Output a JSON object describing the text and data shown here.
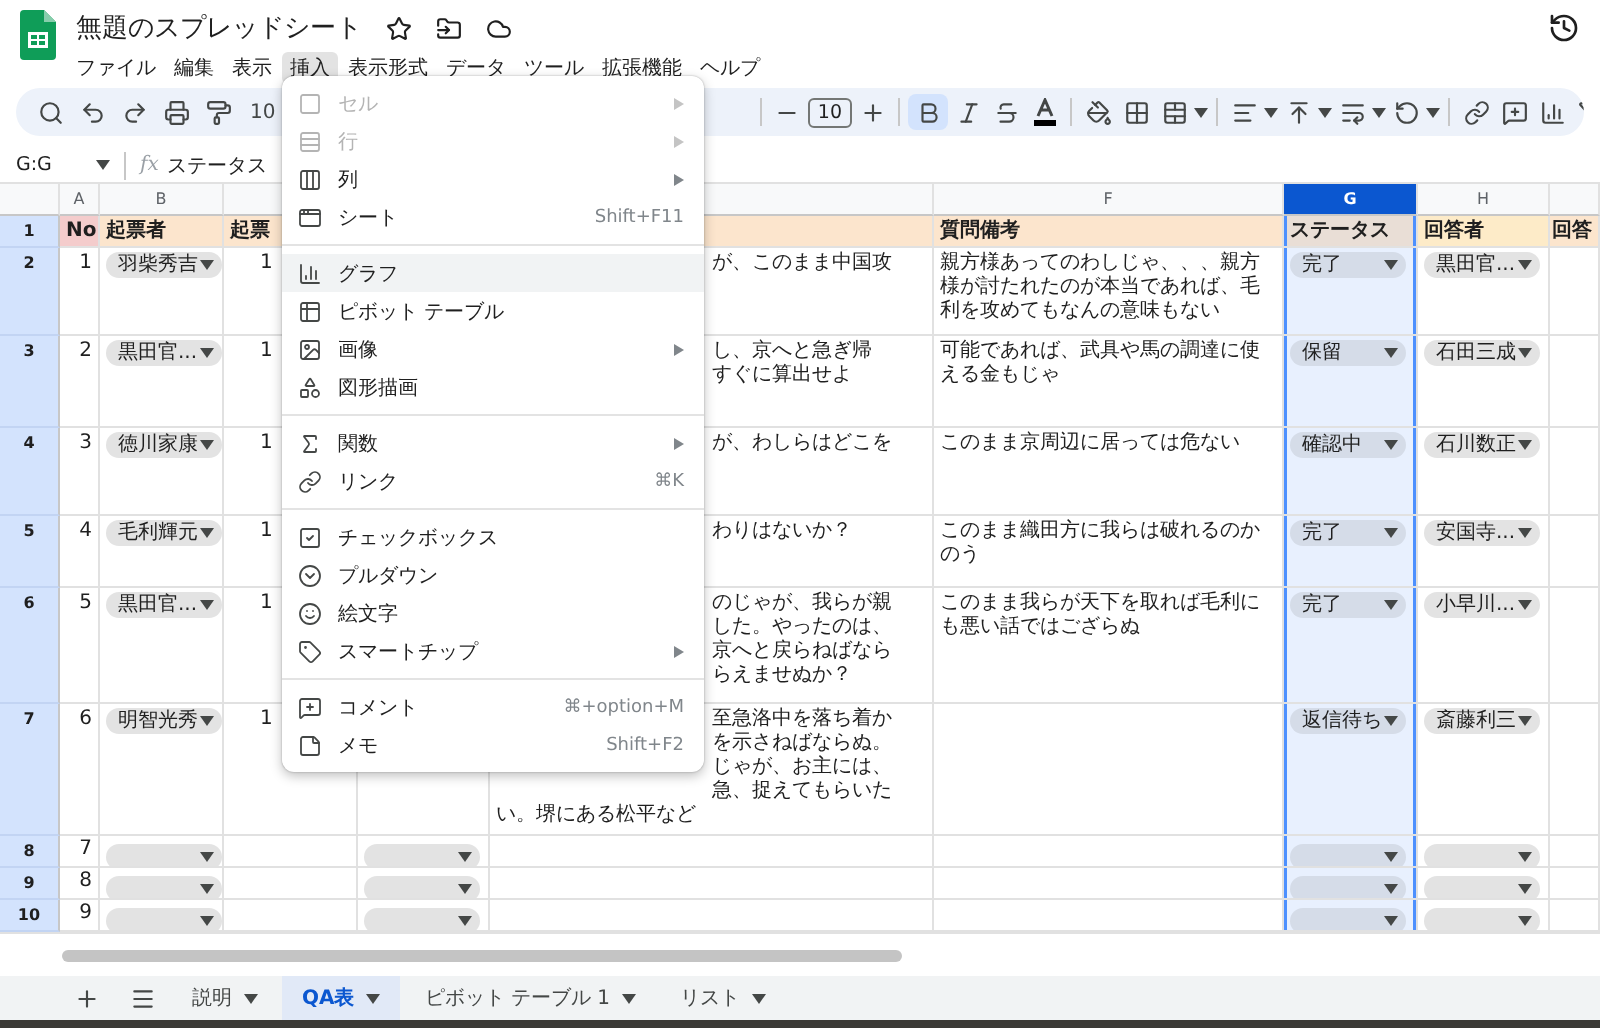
{
  "document": {
    "title": "無題のスプレッドシート"
  },
  "menubar": [
    {
      "label": "ファイル",
      "selected": false
    },
    {
      "label": "編集",
      "selected": false
    },
    {
      "label": "表示",
      "selected": false
    },
    {
      "label": "挿入",
      "selected": true
    },
    {
      "label": "表示形式",
      "selected": false
    },
    {
      "label": "データ",
      "selected": false
    },
    {
      "label": "ツール",
      "selected": false
    },
    {
      "label": "拡張機能",
      "selected": false
    },
    {
      "label": "ヘルプ",
      "selected": false
    }
  ],
  "toolbar": {
    "zoom": "10",
    "font_size": "10",
    "bold_selected": true
  },
  "formula_bar": {
    "name_box": "G:G",
    "fx_label": "fx",
    "content": "ステータス"
  },
  "column_headers": [
    {
      "letter": "A",
      "selected": false
    },
    {
      "letter": "B",
      "selected": false
    },
    {
      "letter": "F",
      "selected": false
    },
    {
      "letter": "G",
      "selected": true
    },
    {
      "letter": "H",
      "selected": false
    }
  ],
  "header_row": {
    "number": "1",
    "no": "No",
    "requester": "起票者",
    "column_c": "起票",
    "note": "質問備考",
    "status": "ステータス",
    "responder": "回答者",
    "column_i": "回答"
  },
  "rows": [
    {
      "kind": "entry",
      "number": "2",
      "no": "1",
      "requester": "羽柴秀吉",
      "column_c": "1",
      "column_e": [
        "が、このまま中国攻"
      ],
      "note": "親方様あってのわしじゃ、、、親方様が討たれたのが本当であれば、毛利を攻めてもなんの意味もない",
      "status": "完了",
      "responder": "黒田官..."
    },
    {
      "kind": "entry",
      "number": "3",
      "no": "2",
      "requester": "黒田官...",
      "column_c": "1",
      "column_e": [
        "し、京へと急ぎ帰",
        "すぐに算出せよ"
      ],
      "note": "可能であれば、武具や馬の調達に使える金もじゃ",
      "status": "保留",
      "responder": "石田三成"
    },
    {
      "kind": "entry",
      "number": "4",
      "no": "3",
      "requester": "徳川家康",
      "column_c": "1",
      "column_e": [
        "が、わしらはどこを"
      ],
      "note": "このまま京周辺に居っては危ない",
      "status": "確認中",
      "responder": "石川数正"
    },
    {
      "kind": "entry",
      "number": "5",
      "no": "4",
      "requester": "毛利輝元",
      "column_c": "1",
      "column_e": [
        "わりはないか？"
      ],
      "note": "このまま織田方に我らは破れるのかのう",
      "status": "完了",
      "responder": "安国寺..."
    },
    {
      "kind": "entry",
      "number": "6",
      "no": "5",
      "requester": "黒田官...",
      "column_c": "1",
      "column_e": [
        "のじゃが、我らが親",
        "した。やったのは、",
        "京へと戻らねばなら",
        "らえませぬか？"
      ],
      "note": "このまま我らが天下を取れば毛利にも悪い話ではござらぬ",
      "status": "完了",
      "responder": "小早川..."
    },
    {
      "kind": "entry",
      "number": "7",
      "no": "6",
      "requester": "明智光秀",
      "column_c": "1",
      "column_e": [
        "至急洛中を落ち着か",
        "を示さねばならぬ。",
        "じゃが、お主には、",
        "急、捉えてもらいた"
      ],
      "column_e_tail": "い。堺にある松平など",
      "status": "返信待ち",
      "responder": "斎藤利三"
    },
    {
      "kind": "blank",
      "number": "8",
      "no": "7"
    },
    {
      "kind": "blank",
      "number": "9",
      "no": "8"
    },
    {
      "kind": "blank",
      "number": "10",
      "no": "9"
    }
  ],
  "insert_menu": [
    {
      "kind": "item",
      "label": "セル",
      "disabled": true,
      "submenu": true,
      "highlighted": false
    },
    {
      "kind": "item",
      "label": "行",
      "disabled": true,
      "submenu": true,
      "highlighted": false
    },
    {
      "kind": "item",
      "label": "列",
      "disabled": false,
      "submenu": true,
      "highlighted": false
    },
    {
      "kind": "item",
      "label": "シート",
      "shortcut": "Shift+F11",
      "disabled": false,
      "submenu": false,
      "highlighted": false
    },
    {
      "kind": "divider"
    },
    {
      "kind": "item",
      "label": "グラフ",
      "disabled": false,
      "submenu": false,
      "highlighted": true
    },
    {
      "kind": "item",
      "label": "ピボット テーブル",
      "disabled": false,
      "submenu": false,
      "highlighted": false
    },
    {
      "kind": "item",
      "label": "画像",
      "disabled": false,
      "submenu": true,
      "highlighted": false
    },
    {
      "kind": "item",
      "label": "図形描画",
      "disabled": false,
      "submenu": false,
      "highlighted": false
    },
    {
      "kind": "divider"
    },
    {
      "kind": "item",
      "label": "関数",
      "disabled": false,
      "submenu": true,
      "highlighted": false
    },
    {
      "kind": "item",
      "label": "リンク",
      "shortcut": "⌘K",
      "disabled": false,
      "submenu": false,
      "highlighted": false
    },
    {
      "kind": "divider"
    },
    {
      "kind": "item",
      "label": "チェックボックス",
      "disabled": false,
      "submenu": false,
      "highlighted": false
    },
    {
      "kind": "item",
      "label": "プルダウン",
      "disabled": false,
      "submenu": false,
      "highlighted": false
    },
    {
      "kind": "item",
      "label": "絵文字",
      "disabled": false,
      "submenu": false,
      "highlighted": false
    },
    {
      "kind": "item",
      "label": "スマートチップ",
      "disabled": false,
      "submenu": true,
      "highlighted": false
    },
    {
      "kind": "divider"
    },
    {
      "kind": "item",
      "label": "コメント",
      "shortcut": "⌘+option+M",
      "disabled": false,
      "submenu": false,
      "highlighted": false
    },
    {
      "kind": "item",
      "label": "メモ",
      "shortcut": "Shift+F2",
      "disabled": false,
      "submenu": false,
      "highlighted": false
    }
  ],
  "sheet_tabs": [
    {
      "label": "説明",
      "selected": false
    },
    {
      "label": "QA表",
      "selected": true
    },
    {
      "label": "ピボット テーブル 1",
      "selected": false
    },
    {
      "label": "リスト",
      "selected": false
    }
  ]
}
